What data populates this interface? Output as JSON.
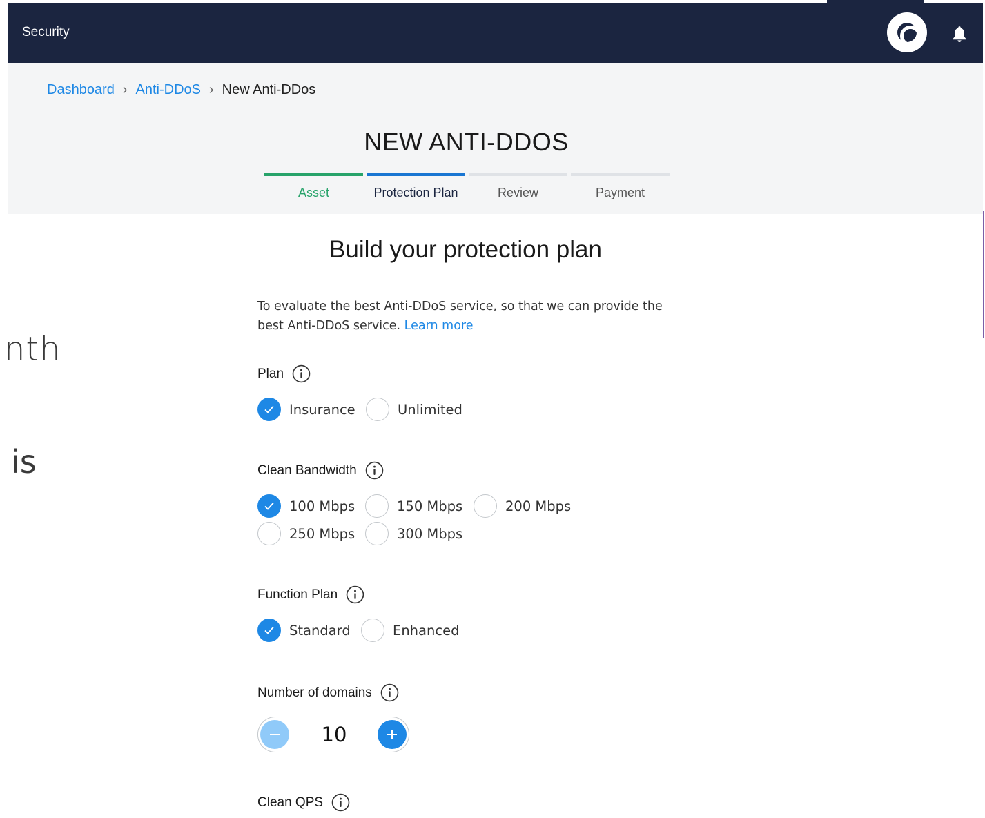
{
  "header": {
    "app_title": "Security"
  },
  "breadcrumb": {
    "items": [
      "Dashboard",
      "Anti-DDoS"
    ],
    "current": "New Anti-DDos"
  },
  "wizard": {
    "title": "NEW ANTI-DDOS",
    "steps": [
      {
        "label": "Asset",
        "state": "done"
      },
      {
        "label": "Protection Plan",
        "state": "active"
      },
      {
        "label": "Review",
        "state": "pending"
      },
      {
        "label": "Payment",
        "state": "pending"
      }
    ]
  },
  "side_fragments": [
    "nth",
    "is"
  ],
  "main": {
    "title": "Build your protection plan",
    "intro": "To evaluate the best Anti-DDoS service, so that we can provide the best Anti-DDoS service. ",
    "learn_more": "Learn more"
  },
  "plan": {
    "label": "Plan",
    "options": [
      "Insurance",
      "Unlimited"
    ],
    "selected": "Insurance"
  },
  "bandwidth": {
    "label": "Clean Bandwidth",
    "options": [
      "100 Mbps",
      "150 Mbps",
      "200 Mbps",
      "250 Mbps",
      "300 Mbps"
    ],
    "selected": "100 Mbps"
  },
  "function_plan": {
    "label": "Function Plan",
    "options": [
      "Standard",
      "Enhanced"
    ],
    "selected": "Standard"
  },
  "domains": {
    "label": "Number of domains",
    "value": "10"
  },
  "qps": {
    "label": "Clean QPS"
  },
  "colors": {
    "nav": "#1b2540",
    "accent": "#1e88e5",
    "success": "#27a36a"
  }
}
